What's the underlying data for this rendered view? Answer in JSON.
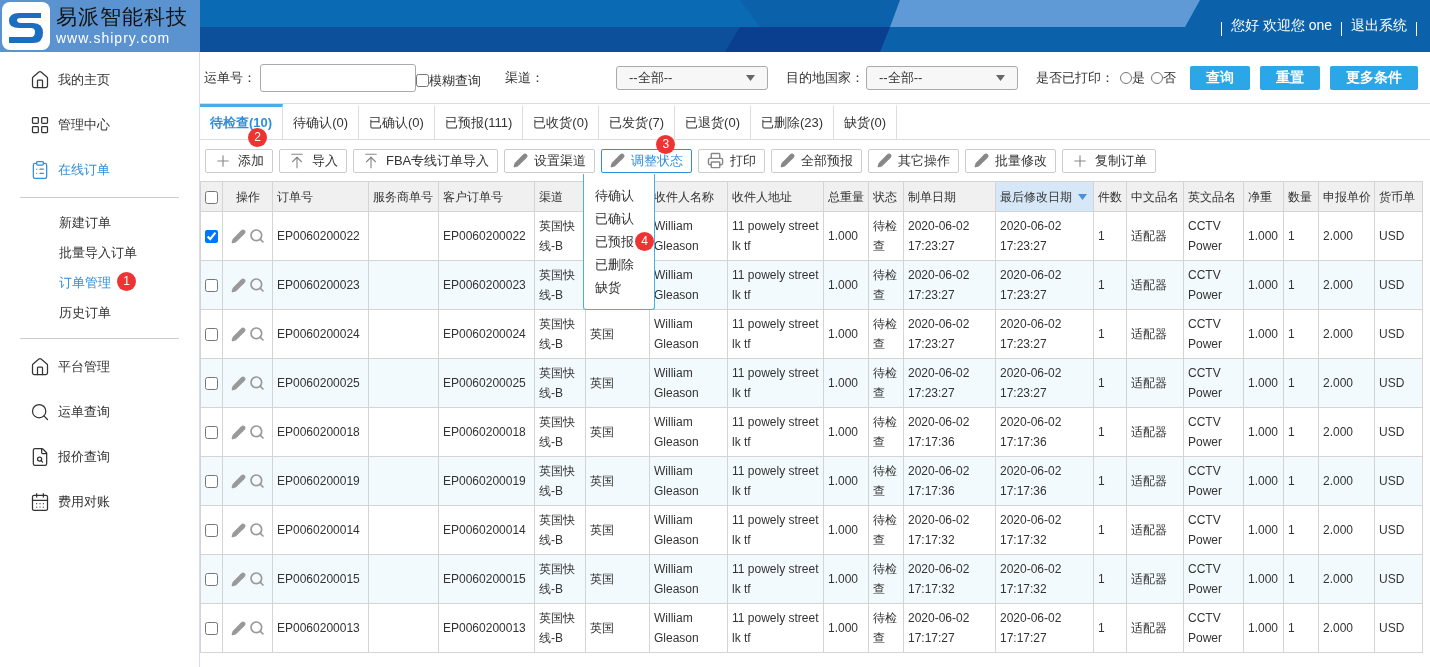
{
  "header": {
    "brand": "易派智能科技",
    "url": "www.shipry.com",
    "links": [
      "您好 欢迎您 one",
      "退出系统"
    ]
  },
  "sidebar": {
    "sections": [
      {
        "items": [
          {
            "label": "我的主页",
            "selected": false
          },
          {
            "label": "管理中心",
            "selected": false
          },
          {
            "label": "在线订单",
            "selected": true
          }
        ]
      },
      {
        "items": [
          {
            "label": "新建订单",
            "selected": false
          },
          {
            "label": "批量导入订单",
            "selected": false
          },
          {
            "label": "订单管理",
            "selected": true,
            "badge": "1"
          },
          {
            "label": "历史订单",
            "selected": false
          }
        ]
      },
      {
        "items": [
          {
            "label": "平台管理",
            "selected": false
          },
          {
            "label": "运单查询",
            "selected": false
          },
          {
            "label": "报价查询",
            "selected": false
          },
          {
            "label": "费用对账",
            "selected": false
          }
        ]
      }
    ]
  },
  "filters": {
    "waybill_label": "运单号：",
    "fuzzy": {
      "label": "模糊查询",
      "checked": false
    },
    "channel": {
      "label": "渠道：",
      "value": "--全部--"
    },
    "country": {
      "label": "目的地国家：",
      "value": "--全部--"
    },
    "printed": {
      "label": "是否已打印：",
      "options": [
        {
          "label": "是",
          "selected": false
        },
        {
          "label": "否",
          "selected": false
        }
      ]
    },
    "buttons": [
      "查询",
      "重置",
      "更多条件"
    ]
  },
  "tabs": [
    {
      "label": "待检查(10)",
      "selected": true,
      "badge": "2"
    },
    {
      "label": "待确认(0)",
      "selected": false
    },
    {
      "label": "已确认(0)",
      "selected": false
    },
    {
      "label": "已预报(111)",
      "selected": false
    },
    {
      "label": "已收货(0)",
      "selected": false
    },
    {
      "label": "已发货(7)",
      "selected": false
    },
    {
      "label": "已退货(0)",
      "selected": false
    },
    {
      "label": "已删除(23)",
      "selected": false
    },
    {
      "label": "缺货(0)",
      "selected": false
    }
  ],
  "toolbar": [
    {
      "label": "添加",
      "kind": "plus",
      "active": false
    },
    {
      "label": "导入",
      "kind": "upload",
      "active": false
    },
    {
      "label": "FBA专线订单导入",
      "kind": "upload",
      "active": false
    },
    {
      "label": "设置渠道",
      "kind": "pencil",
      "active": false
    },
    {
      "label": "调整状态",
      "kind": "pencil",
      "active": true,
      "badge": "3"
    },
    {
      "label": "打印",
      "kind": "printer",
      "active": false
    },
    {
      "label": "全部预报",
      "kind": "pencil",
      "active": false
    },
    {
      "label": "其它操作",
      "kind": "pencil",
      "active": false
    },
    {
      "label": "批量修改",
      "kind": "pencil",
      "active": false
    },
    {
      "label": "复制订单",
      "kind": "plus",
      "active": false
    }
  ],
  "status_menu": [
    {
      "label": "待确认"
    },
    {
      "label": "已确认"
    },
    {
      "label": "已预报",
      "badge": "4"
    },
    {
      "label": "已删除"
    },
    {
      "label": "缺货"
    }
  ],
  "table": {
    "all_checked": false,
    "action_header": "操作",
    "columns": [
      {
        "label": "订单号",
        "sorted": false
      },
      {
        "label": "服务商单号",
        "sorted": false
      },
      {
        "label": "客户订单号",
        "sorted": false
      },
      {
        "label": "渠道",
        "sorted": false
      },
      {},
      {
        "label": "收件人名称",
        "sorted": false
      },
      {
        "label": "收件人地址",
        "sorted": false
      },
      {
        "label": "总重量",
        "sorted": false
      },
      {
        "label": "状态",
        "sorted": false
      },
      {
        "label": "制单日期",
        "sorted": false
      },
      {
        "label": "最后修改日期",
        "sorted": true
      },
      {
        "label": "件数",
        "sorted": false
      },
      {
        "label": "中文品名",
        "sorted": false
      },
      {
        "label": "英文品名",
        "sorted": false
      },
      {
        "label": "净重",
        "sorted": false
      },
      {
        "label": "数量",
        "sorted": false
      },
      {
        "label": "申报单价",
        "sorted": false
      },
      {
        "label": "货币单",
        "sorted": false
      }
    ],
    "rows": [
      {
        "checked": true,
        "cells": [
          "EP0060200022",
          "",
          "EP0060200022",
          "英国快线-B",
          null,
          "William Gleason",
          "11 powely street lk tf",
          "1.000",
          "待检查",
          "2020-06-02 17:23:27",
          "2020-06-02 17:23:27",
          "1",
          "适配器",
          "CCTV Power",
          "1.000",
          "1",
          "2.000",
          "USD"
        ]
      },
      {
        "checked": false,
        "cells": [
          "EP0060200023",
          "",
          "EP0060200023",
          "英国快线-B",
          null,
          "William Gleason",
          "11 powely street lk tf",
          "1.000",
          "待检查",
          "2020-06-02 17:23:27",
          "2020-06-02 17:23:27",
          "1",
          "适配器",
          "CCTV Power",
          "1.000",
          "1",
          "2.000",
          "USD"
        ]
      },
      {
        "checked": false,
        "cells": [
          "EP0060200024",
          "",
          "EP0060200024",
          "英国快线-B",
          "英国",
          "William Gleason",
          "11 powely street lk tf",
          "1.000",
          "待检查",
          "2020-06-02 17:23:27",
          "2020-06-02 17:23:27",
          "1",
          "适配器",
          "CCTV Power",
          "1.000",
          "1",
          "2.000",
          "USD"
        ]
      },
      {
        "checked": false,
        "cells": [
          "EP0060200025",
          "",
          "EP0060200025",
          "英国快线-B",
          "英国",
          "William Gleason",
          "11 powely street lk tf",
          "1.000",
          "待检查",
          "2020-06-02 17:23:27",
          "2020-06-02 17:23:27",
          "1",
          "适配器",
          "CCTV Power",
          "1.000",
          "1",
          "2.000",
          "USD"
        ]
      },
      {
        "checked": false,
        "cells": [
          "EP0060200018",
          "",
          "EP0060200018",
          "英国快线-B",
          "英国",
          "William Gleason",
          "11 powely street lk tf",
          "1.000",
          "待检查",
          "2020-06-02 17:17:36",
          "2020-06-02 17:17:36",
          "1",
          "适配器",
          "CCTV Power",
          "1.000",
          "1",
          "2.000",
          "USD"
        ]
      },
      {
        "checked": false,
        "cells": [
          "EP0060200019",
          "",
          "EP0060200019",
          "英国快线-B",
          "英国",
          "William Gleason",
          "11 powely street lk tf",
          "1.000",
          "待检查",
          "2020-06-02 17:17:36",
          "2020-06-02 17:17:36",
          "1",
          "适配器",
          "CCTV Power",
          "1.000",
          "1",
          "2.000",
          "USD"
        ]
      },
      {
        "checked": false,
        "cells": [
          "EP0060200014",
          "",
          "EP0060200014",
          "英国快线-B",
          "英国",
          "William Gleason",
          "11 powely street lk tf",
          "1.000",
          "待检查",
          "2020-06-02 17:17:32",
          "2020-06-02 17:17:32",
          "1",
          "适配器",
          "CCTV Power",
          "1.000",
          "1",
          "2.000",
          "USD"
        ]
      },
      {
        "checked": false,
        "cells": [
          "EP0060200015",
          "",
          "EP0060200015",
          "英国快线-B",
          "英国",
          "William Gleason",
          "11 powely street lk tf",
          "1.000",
          "待检查",
          "2020-06-02 17:17:32",
          "2020-06-02 17:17:32",
          "1",
          "适配器",
          "CCTV Power",
          "1.000",
          "1",
          "2.000",
          "USD"
        ]
      },
      {
        "checked": false,
        "cells": [
          "EP0060200013",
          "",
          "EP0060200013",
          "英国快线-B",
          "英国",
          "William Gleason",
          "11 powely street lk tf",
          "1.000",
          "待检查",
          "2020-06-02 17:17:27",
          "2020-06-02 17:17:27",
          "1",
          "适配器",
          "CCTV Power",
          "1.000",
          "1",
          "2.000",
          "USD"
        ]
      }
    ]
  }
}
